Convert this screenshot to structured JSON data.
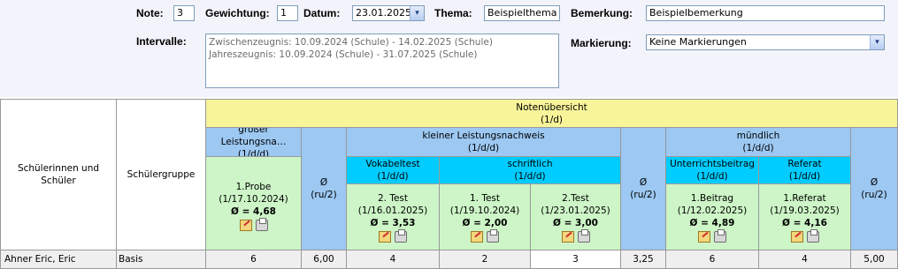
{
  "form": {
    "note_label": "Note:",
    "note_value": "3",
    "weight_label": "Gewichtung:",
    "weight_value": "1",
    "date_label": "Datum:",
    "date_value": "23.01.2025",
    "topic_label": "Thema:",
    "topic_value": "Beispielthema",
    "remark_label": "Bemerkung:",
    "remark_value": "Beispielbemerkung",
    "intervals_label": "Intervalle:",
    "intervals": [
      "Zwischenzeugnis: 10.09.2024 (Schule) - 14.02.2025 (Schule)",
      "Jahreszeugnis: 10.09.2024 (Schule) - 31.07.2025 (Schule)"
    ],
    "marking_label": "Markierung:",
    "marking_value": "Keine Markierungen",
    "dropdown_glyph": "▾"
  },
  "table": {
    "students_header": "Schülerinnen und Schüler",
    "group_header": "Schülergruppe",
    "overview": {
      "title": "Notenübersicht",
      "sub": "(1/d)"
    },
    "big": {
      "title": "großer Leistungsna…",
      "sub": "(1/d/d)"
    },
    "small": {
      "title": "kleiner Leistungsnachweis",
      "sub": "(1/d/d)"
    },
    "oral": {
      "title": "mündlich",
      "sub": "(1/d/d)"
    },
    "vokabeltest": {
      "title": "Vokabeltest",
      "sub": "(1/d/d)"
    },
    "schriftlich": {
      "title": "schriftlich",
      "sub": "(1/d/d)"
    },
    "unterricht": {
      "title": "Unterrichtsbeitrag",
      "sub": "(1/d/d)"
    },
    "referat": {
      "title": "Referat",
      "sub": "(1/d/d)"
    },
    "avg_symbol": "Ø",
    "avg_sub": "(ru/2)",
    "tests": [
      {
        "name": "1.Probe",
        "date": "(1/17.10.2024)",
        "avg": "Ø = 4,68"
      },
      {
        "name": "2. Test",
        "date": "(1/16.01.2025)",
        "avg": "Ø = 3,53"
      },
      {
        "name": "1. Test",
        "date": "(1/19.10.2024)",
        "avg": "Ø = 2,00"
      },
      {
        "name": "2.Test",
        "date": "(1/23.01.2025)",
        "avg": "Ø = 3,00"
      },
      {
        "name": "1.Beitrag",
        "date": "(1/12.02.2025)",
        "avg": "Ø = 4,89"
      },
      {
        "name": "1.Referat",
        "date": "(1/19.03.2025)",
        "avg": "Ø = 4,16"
      }
    ],
    "row": {
      "student": "Ahner Eric, Eric",
      "group": "Basis",
      "cells": [
        "6",
        "6,00",
        "4",
        "2",
        "3",
        "3,25",
        "6",
        "4",
        "5,00"
      ]
    }
  },
  "colors": {
    "overview": "#f8f49a",
    "category": "#9cc8f2",
    "subcategory": "#00ccff",
    "test": "#cdf5c7"
  }
}
